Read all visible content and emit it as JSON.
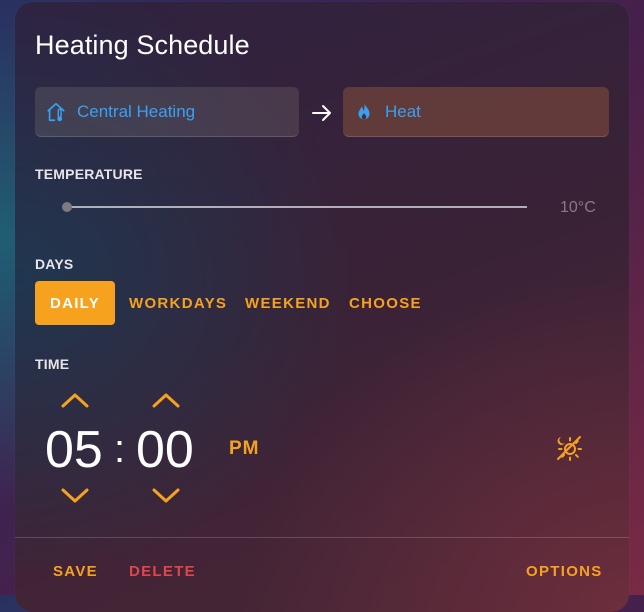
{
  "title": "Heating Schedule",
  "entity_picker": {
    "label": "Central Heating",
    "icon": "thermostat-home-icon"
  },
  "action_picker": {
    "label": "Heat",
    "icon": "fire-icon"
  },
  "temperature": {
    "label": "TEMPERATURE",
    "value_text": "10°C",
    "slider_level": 0
  },
  "days": {
    "label": "DAYS",
    "options": [
      "DAILY",
      "WORKDAYS",
      "WEEKEND",
      "CHOOSE"
    ],
    "selected": "DAILY"
  },
  "time": {
    "label": "TIME",
    "hours": "05",
    "separator": ":",
    "minutes": "00",
    "period": "PM",
    "sun_icon": "sun-moon-icon"
  },
  "footer": {
    "save": "SAVE",
    "delete": "DELETE",
    "options": "OPTIONS"
  },
  "colors": {
    "accent": "#f6a21e",
    "picker_text": "#3aa0f2",
    "delete": "#e0454a"
  }
}
